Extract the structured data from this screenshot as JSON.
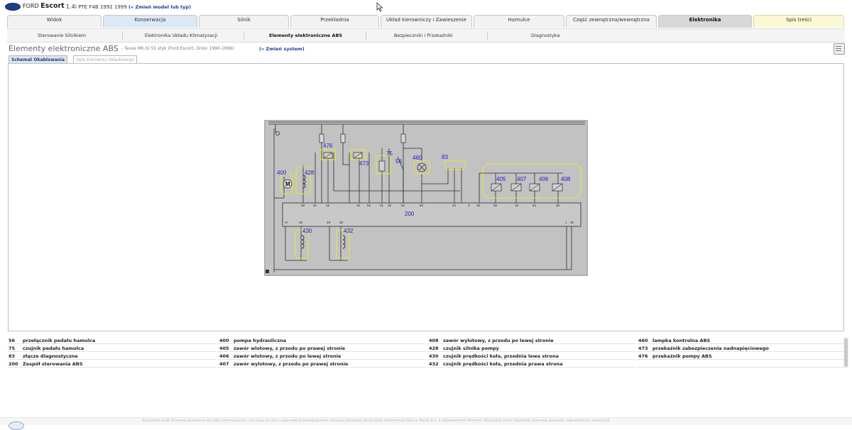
{
  "header": {
    "brand": "FORD",
    "model": "Escort",
    "engine": "1.4i",
    "engine_code": "PTE F4B 1992 1999",
    "change_model": "(« Zmień model lub typ)"
  },
  "tabs": [
    "Widok",
    "Konserwacja",
    "Silnik",
    "Przekładnia",
    "Układ kierowniczy i Zawieszenie",
    "Hamulce",
    "Część zewnętrzna/wewnętrzna",
    "Elektronika",
    "Spis treści"
  ],
  "active_tab": "Elektronika",
  "subnav": [
    "Sterowanie Silnikiem",
    "Elektronika Układu Klimatyzacji",
    "Elementy elektroniczne ABS",
    "Bezpieczniki i Przekaźniki",
    "Diagnostyka"
  ],
  "active_subnav": "Elementy elektroniczne ABS",
  "page": {
    "title": "Elementy elektroniczne ABS",
    "system_info": "- Teves MK.IV 55 styk (Ford Escort, Orion 1990-1996)",
    "change_system": "(« Zmień system)"
  },
  "inner_tabs": [
    "Schemat Okablowania",
    "Opis Elementu Składowego"
  ],
  "diagram": {
    "component_labels": [
      "476",
      "400",
      "428",
      "75",
      "56",
      "460",
      "83",
      "473",
      "405",
      "407",
      "406",
      "408",
      "200",
      "430",
      "432"
    ],
    "pin_labels": [
      "49",
      "31",
      "15",
      "34",
      "53",
      "41",
      "16",
      "52",
      "50",
      "23",
      "3",
      "33",
      "55",
      "18",
      "54",
      "36",
      "47",
      "29",
      "48",
      "30",
      "1",
      "19"
    ]
  },
  "legend": [
    [
      {
        "num": "56",
        "text": "przełącznik pedału hamulca"
      },
      {
        "num": "400",
        "text": "pompa hydrauliczna"
      },
      {
        "num": "408",
        "text": "zawór wylotowy, z przodu po lewej stronie"
      },
      {
        "num": "460",
        "text": "lampka kontrolna ABS"
      }
    ],
    [
      {
        "num": "75",
        "text": "czujnik pedału hamulca"
      },
      {
        "num": "405",
        "text": "zawór wlotowy, z przodu po prawej stronie"
      },
      {
        "num": "428",
        "text": "czujnik silnika pompy"
      },
      {
        "num": "473",
        "text": "przekaźnik zabezpieczenia nadnapięciowego"
      }
    ],
    [
      {
        "num": "83",
        "text": "złącze diagnostyczne"
      },
      {
        "num": "406",
        "text": "zawór wlotowy, z przodu po lewej stronie"
      },
      {
        "num": "430",
        "text": "czujnik prędkości koła, przednia lewa strona"
      },
      {
        "num": "476",
        "text": "przekaźnik pompy ABS"
      }
    ],
    [
      {
        "num": "200",
        "text": "Zespół sterowania ABS"
      },
      {
        "num": "407",
        "text": "zawór wylotowy, z przodu po prawej stronie"
      },
      {
        "num": "432",
        "text": "czujnik prędkości koła, przednia prawa strona"
      },
      {
        "num": "",
        "text": ""
      }
    ]
  ],
  "footer": "Wszystkie znaki firmowe podawane są tylko informacyjnie i nie mają na celu sugerowania jakiegokolwiek związku pomiędzy firmą Vivid Automotive Data & Media B.V. a odpowiednimi firmami. Wszystkie znaki handlowe stanowią własność odpowiednich właścicieli",
  "colors": {
    "diagram_bg": "#c2c2c2",
    "component_outline": "#e6e63c",
    "label": "#2020d0",
    "link": "#1d3d9c"
  }
}
